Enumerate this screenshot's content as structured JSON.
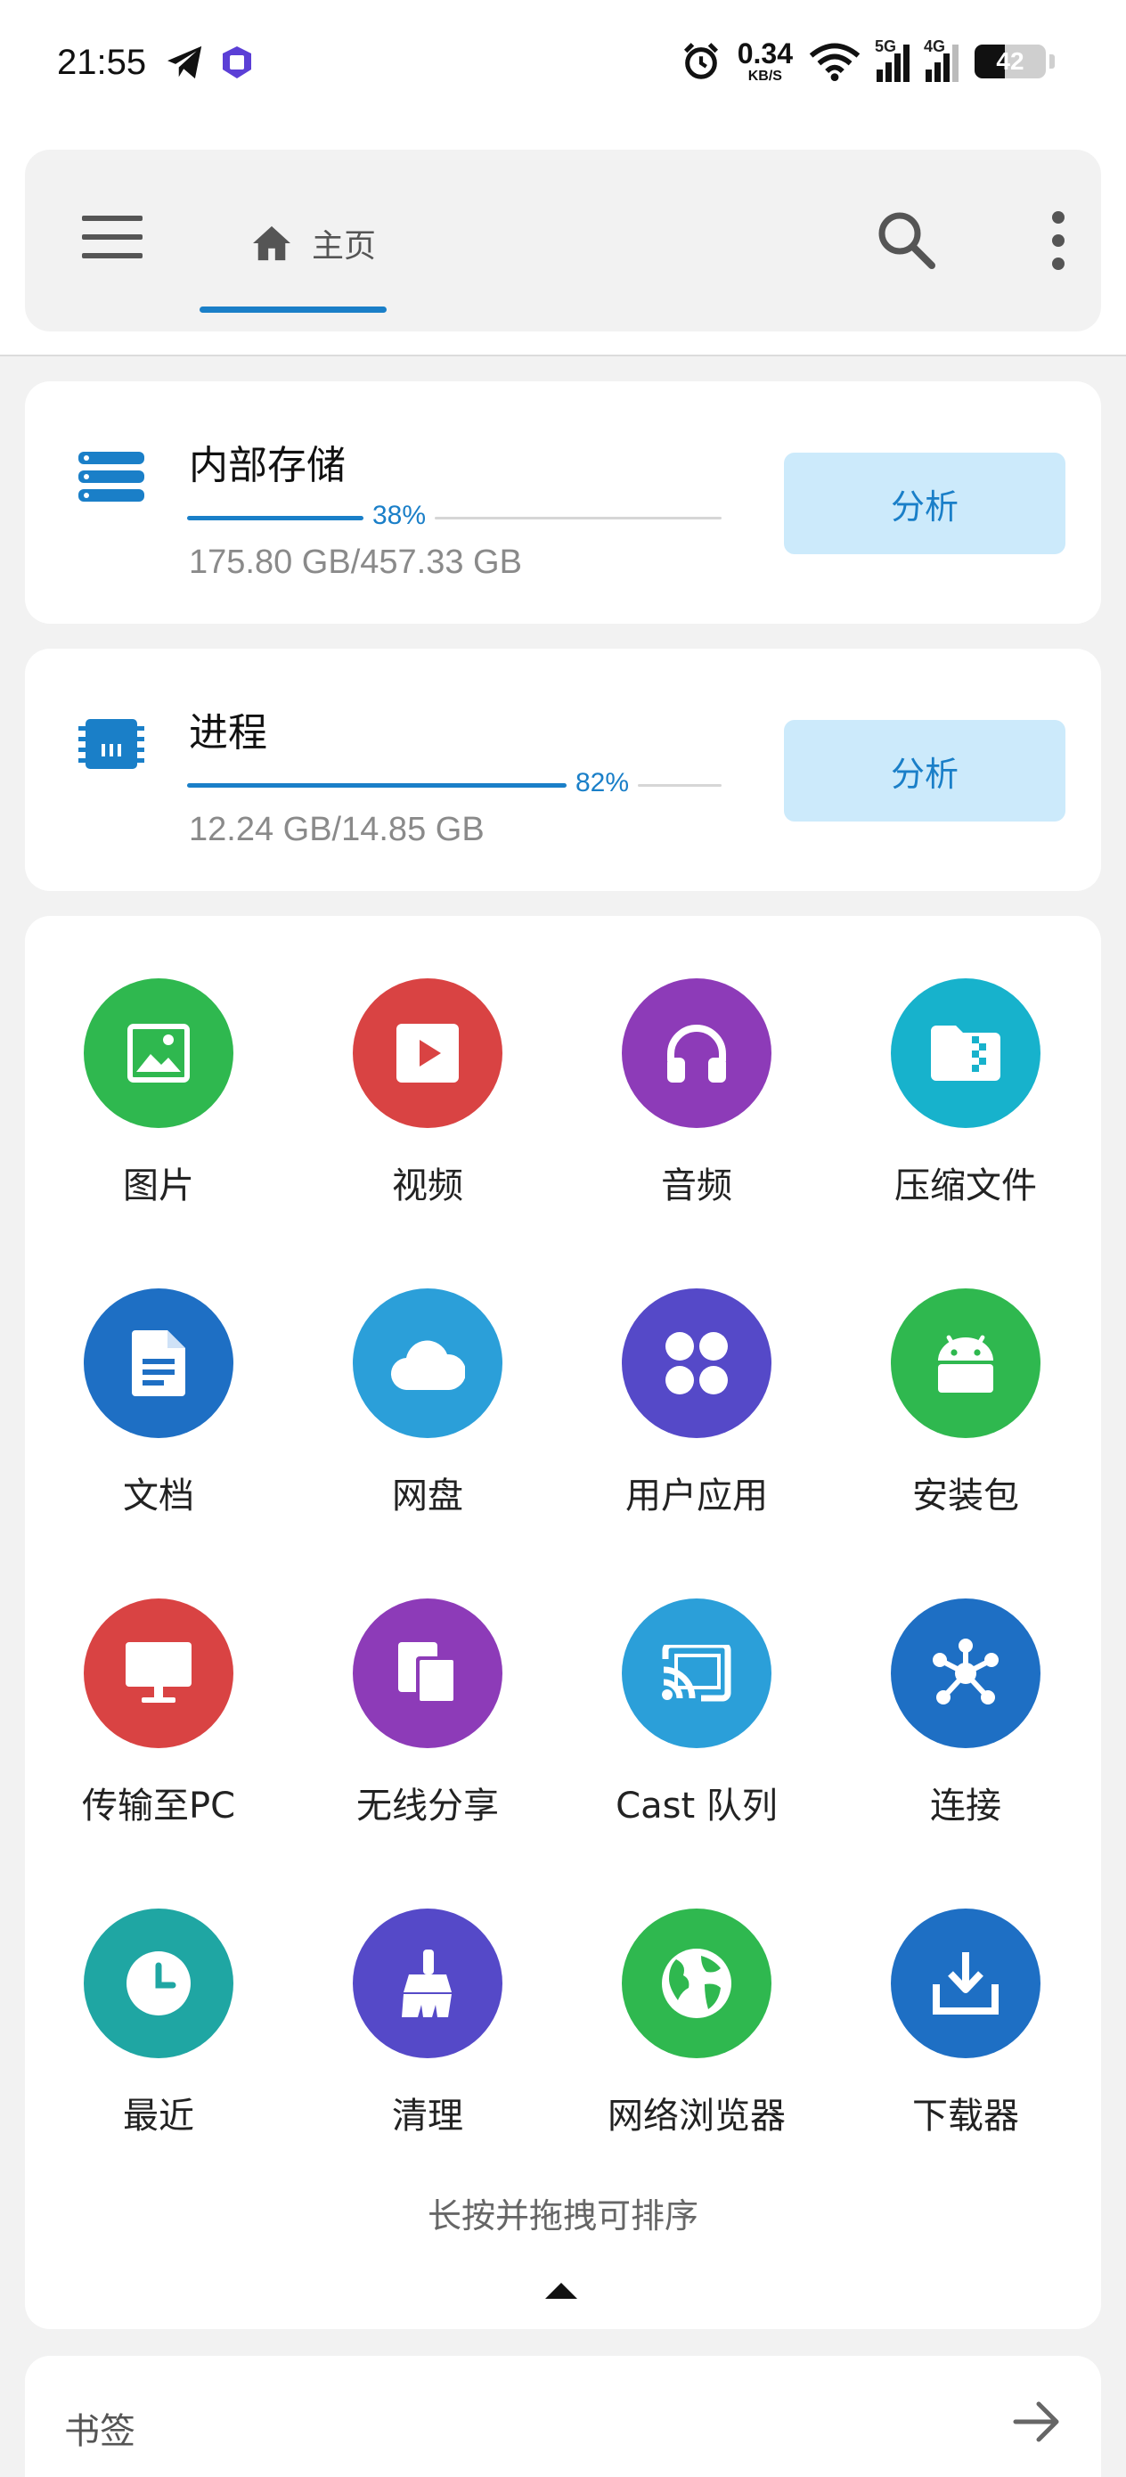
{
  "status_bar": {
    "time": "21:55",
    "net_speed_value": "0.34",
    "net_speed_unit": "KB/S",
    "signal_1_label": "5G",
    "signal_2_label": "4G",
    "battery_level": "42",
    "icons": [
      "telegram-icon",
      "tieba-icon",
      "alarm-icon",
      "wifi-icon",
      "signal-5g-icon",
      "signal-4g-icon",
      "battery-icon"
    ]
  },
  "toolbar": {
    "home_label": "主页",
    "icons": [
      "menu-icon",
      "home-icon",
      "search-icon",
      "more-vert-icon"
    ]
  },
  "storage": {
    "title": "内部存储",
    "percent": 38,
    "percent_label": "38%",
    "sizes": "175.80 GB/457.33 GB",
    "button_label": "分析"
  },
  "process": {
    "title": "进程",
    "percent": 82,
    "percent_label": "82%",
    "sizes": "12.24 GB/14.85 GB",
    "button_label": "分析"
  },
  "grid": {
    "items": [
      {
        "label": "图片",
        "color": "#2fb84f",
        "icon": "image-icon"
      },
      {
        "label": "视频",
        "color": "#d94343",
        "icon": "video-icon"
      },
      {
        "label": "音频",
        "color": "#8d3bb8",
        "icon": "headphones-icon"
      },
      {
        "label": "压缩文件",
        "color": "#17b2cc",
        "icon": "archive-icon"
      },
      {
        "label": "文档",
        "color": "#1e6fc4",
        "icon": "document-icon"
      },
      {
        "label": "网盘",
        "color": "#2b9fd9",
        "icon": "cloud-icon"
      },
      {
        "label": "用户应用",
        "color": "#5549c8",
        "icon": "apps-icon"
      },
      {
        "label": "安装包",
        "color": "#2fb84f",
        "icon": "android-icon"
      },
      {
        "label": "传输至PC",
        "color": "#d94343",
        "icon": "monitor-icon"
      },
      {
        "label": "无线分享",
        "color": "#8d3bb8",
        "icon": "share-devices-icon"
      },
      {
        "label": "Cast 队列",
        "color": "#2b9fd9",
        "icon": "cast-icon"
      },
      {
        "label": "连接",
        "color": "#1e6fc4",
        "icon": "network-icon"
      },
      {
        "label": "最近",
        "color": "#1fa6a3",
        "icon": "clock-icon"
      },
      {
        "label": "清理",
        "color": "#5549c8",
        "icon": "broom-icon"
      },
      {
        "label": "网络浏览器",
        "color": "#2fb84f",
        "icon": "globe-icon"
      },
      {
        "label": "下载器",
        "color": "#1e6fc4",
        "icon": "download-icon"
      }
    ],
    "hint": "长按并拖拽可排序"
  },
  "bookmarks": {
    "title": "书签",
    "icon": "arrow-right-icon"
  },
  "colors": {
    "accent": "#1a7fc8",
    "button_bg": "#cceafb",
    "page_bg": "#f2f2f2"
  }
}
